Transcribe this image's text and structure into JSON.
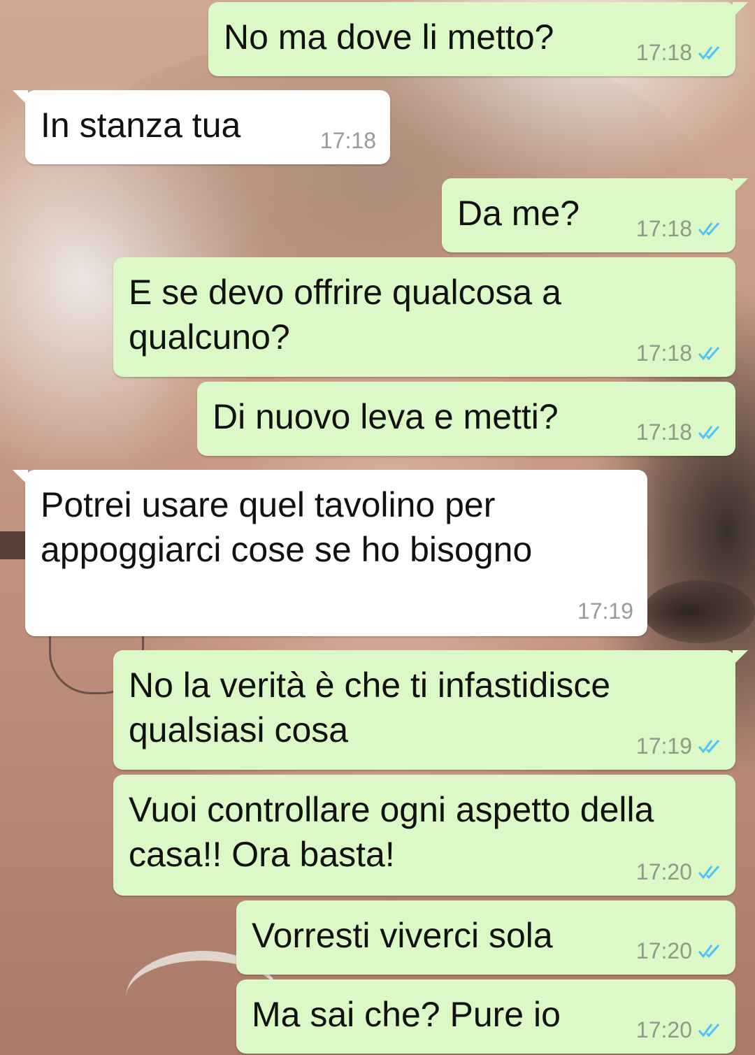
{
  "colors": {
    "outgoing_bubble": "#dcf8c6",
    "incoming_bubble": "#ffffff",
    "read_ticks": "#4fc3f7"
  },
  "messages": [
    {
      "direction": "out",
      "text": "No ma dove li metto?",
      "time": "17:18",
      "status": "read"
    },
    {
      "direction": "in",
      "text": "In stanza tua",
      "time": "17:18"
    },
    {
      "direction": "out",
      "text": "Da me?",
      "time": "17:18",
      "status": "read"
    },
    {
      "direction": "out",
      "text": "E se devo offrire qualcosa a\nqualcuno?",
      "time": "17:18",
      "status": "read"
    },
    {
      "direction": "out",
      "text": "Di nuovo leva e metti?",
      "time": "17:18",
      "status": "read"
    },
    {
      "direction": "in",
      "text": "Potrei usare quel tavolino per\nappoggiarci cose se ho bisogno",
      "time": "17:19"
    },
    {
      "direction": "out",
      "text": "No la verità è che ti infastidisce\nqualsiasi cosa",
      "time": "17:19",
      "status": "read"
    },
    {
      "direction": "out",
      "text": "Vuoi controllare ogni aspetto della\ncasa!! Ora basta!",
      "time": "17:20",
      "status": "read"
    },
    {
      "direction": "out",
      "text": "Vorresti viverci sola",
      "time": "17:20",
      "status": "read"
    },
    {
      "direction": "out",
      "text": "Ma sai che? Pure io",
      "time": "17:20",
      "status": "read"
    }
  ]
}
